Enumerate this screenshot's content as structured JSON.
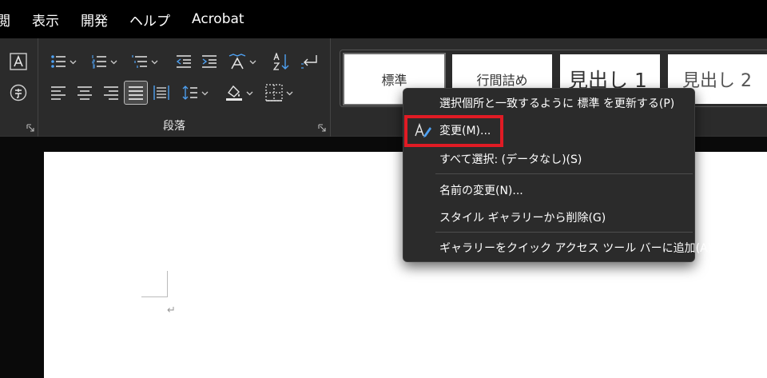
{
  "menubar": {
    "items": [
      "閲",
      "表示",
      "開発",
      "ヘルプ",
      "Acrobat"
    ]
  },
  "ribbon": {
    "paragraph_group_label": "段落"
  },
  "styles_gallery": {
    "styles": [
      "標準",
      "行間詰め",
      "見出し 1",
      "見出し 2"
    ]
  },
  "document": {
    "paragraph_mark": "↵"
  },
  "context_menu": {
    "items": [
      "選択個所と一致するように 標準 を更新する(P)",
      "変更(M)...",
      "すべて選択: (データなし)(S)",
      "名前の変更(N)...",
      "スタイル ギャラリーから削除(G)",
      "ギャラリーをクイック アクセス ツール バーに追加(A)"
    ]
  },
  "colors": {
    "highlight": "#e01b24",
    "ribbon_bg": "#2b2b2b",
    "menu_bg": "#2b2b2b",
    "accent_blue": "#4ea1f3"
  },
  "icons": [
    "font-color-a-icon",
    "phonetic-guide-icon",
    "bullets-icon",
    "numbering-icon",
    "multilevel-list-icon",
    "decrease-indent-icon",
    "increase-indent-icon",
    "asian-layout-icon",
    "sort-icon",
    "show-formatting-marks-icon",
    "align-left-icon",
    "align-center-icon",
    "align-right-icon",
    "justify-icon",
    "distributed-icon",
    "line-spacing-icon",
    "shading-icon",
    "borders-icon",
    "modify-style-icon",
    "dialog-launcher-icon"
  ]
}
